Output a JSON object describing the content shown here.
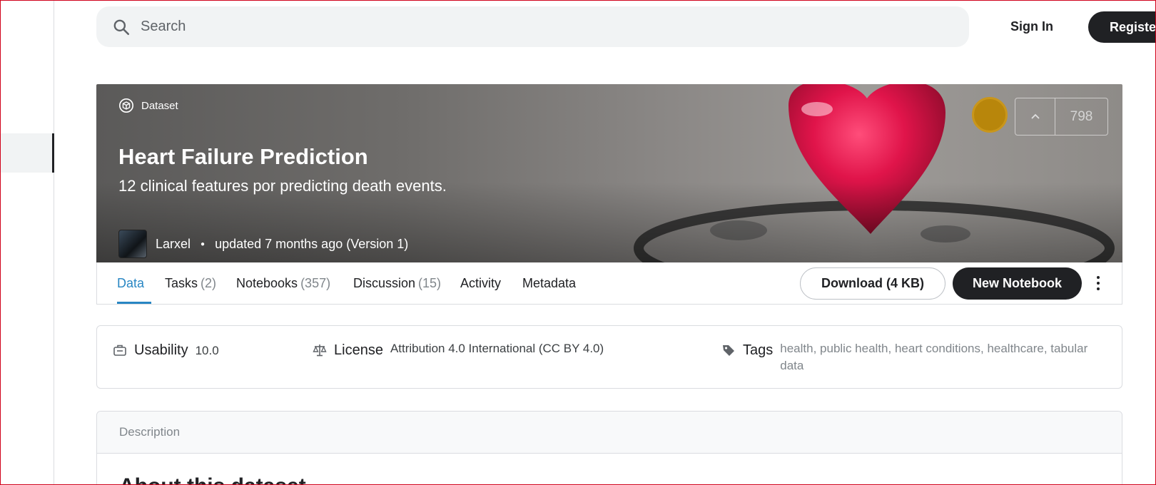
{
  "search": {
    "placeholder": "Search"
  },
  "auth": {
    "signin_label": "Sign In",
    "register_label": "Register"
  },
  "hero": {
    "type_label": "Dataset",
    "title": "Heart Failure Prediction",
    "subtitle": "12 clinical features por predicting death events.",
    "owner": "Larxel",
    "updated": "updated 7 months ago (Version 1)",
    "vote_count": "798"
  },
  "tabs": [
    {
      "label": "Data",
      "count": ""
    },
    {
      "label": "Tasks",
      "count": "(2)"
    },
    {
      "label": "Notebooks",
      "count": "(357)"
    },
    {
      "label": "Discussion",
      "count": "(15)"
    },
    {
      "label": "Activity",
      "count": ""
    },
    {
      "label": "Metadata",
      "count": ""
    }
  ],
  "actions": {
    "download_label": "Download (4 KB)",
    "new_notebook_label": "New Notebook"
  },
  "meta": {
    "usability_label": "Usability",
    "usability_value": "10.0",
    "license_label": "License",
    "license_value": "Attribution 4.0 International (CC BY 4.0)",
    "tags_label": "Tags",
    "tags": [
      "health",
      "public health",
      "heart conditions",
      "healthcare",
      "tabular data"
    ]
  },
  "description": {
    "header": "Description",
    "title": "About this dataset"
  },
  "colors": {
    "accent": "#2886c3",
    "dark": "#202124",
    "medal": "#b8860b"
  },
  "icons": [
    "search-icon",
    "dataset-icon",
    "upvote-icon",
    "usability-icon",
    "license-icon",
    "tag-icon",
    "more-vert-icon"
  ]
}
